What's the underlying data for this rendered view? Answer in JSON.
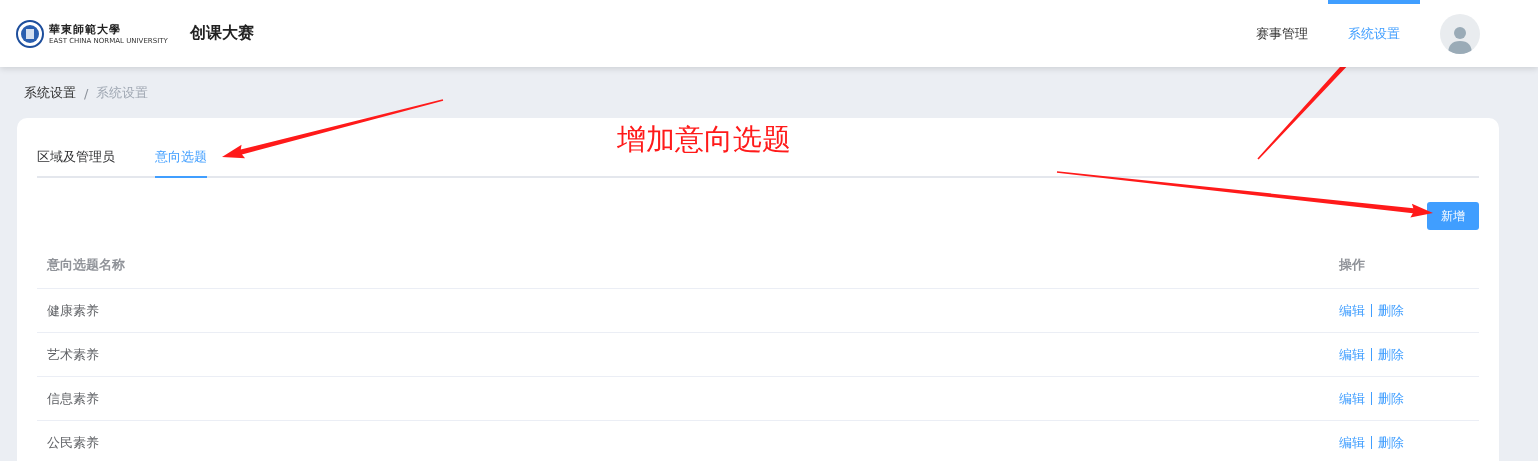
{
  "header": {
    "logo": {
      "name": "華東師範大學",
      "subtitle": "EAST CHINA NORMAL UNIVERSITY"
    },
    "title": "创课大赛",
    "nav": [
      {
        "label": "赛事管理",
        "selected": false
      },
      {
        "label": "系统设置",
        "selected": true
      }
    ]
  },
  "breadcrumb": {
    "items": [
      "系统设置",
      "系统设置"
    ],
    "separator": "/"
  },
  "tabs": [
    {
      "label": "区域及管理员",
      "selected": false
    },
    {
      "label": "意向选题",
      "selected": true
    }
  ],
  "add_button": "新增",
  "table": {
    "columns": [
      "意向选题名称",
      "操作"
    ],
    "rows": [
      {
        "name": "健康素养",
        "actions": [
          "编辑",
          "删除"
        ]
      },
      {
        "name": "艺术素养",
        "actions": [
          "编辑",
          "删除"
        ]
      },
      {
        "name": "信息素养",
        "actions": [
          "编辑",
          "删除"
        ]
      },
      {
        "name": "公民素养",
        "actions": [
          "编辑",
          "删除"
        ]
      }
    ]
  },
  "annotation": {
    "text": "增加意向选题"
  }
}
